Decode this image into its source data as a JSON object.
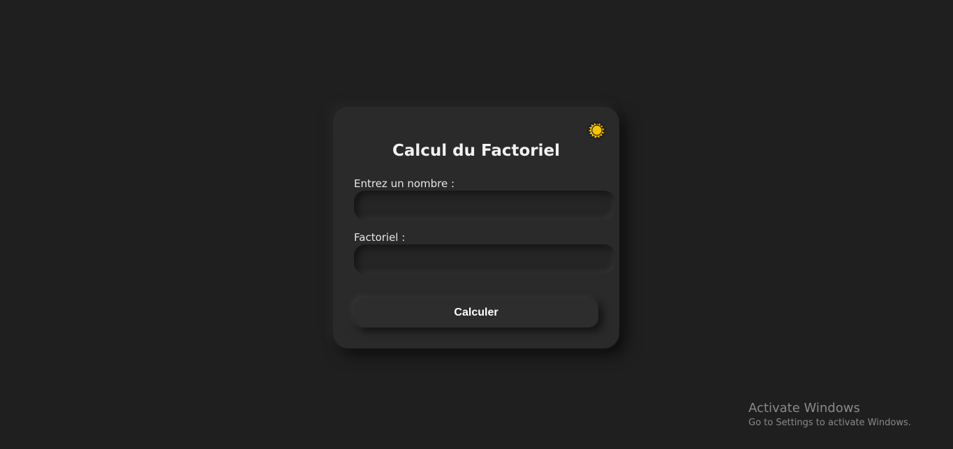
{
  "card": {
    "title": "Calcul du Factoriel",
    "theme_icon": "sun-icon",
    "accent_color": "#f5c400",
    "number_label": "Entrez un nombre :",
    "number_value": "",
    "factorial_label": "Factoriel :",
    "factorial_value": "",
    "calculate_label": "Calculer"
  },
  "watermark": {
    "title": "Activate Windows",
    "subtitle": "Go to Settings to activate Windows."
  }
}
